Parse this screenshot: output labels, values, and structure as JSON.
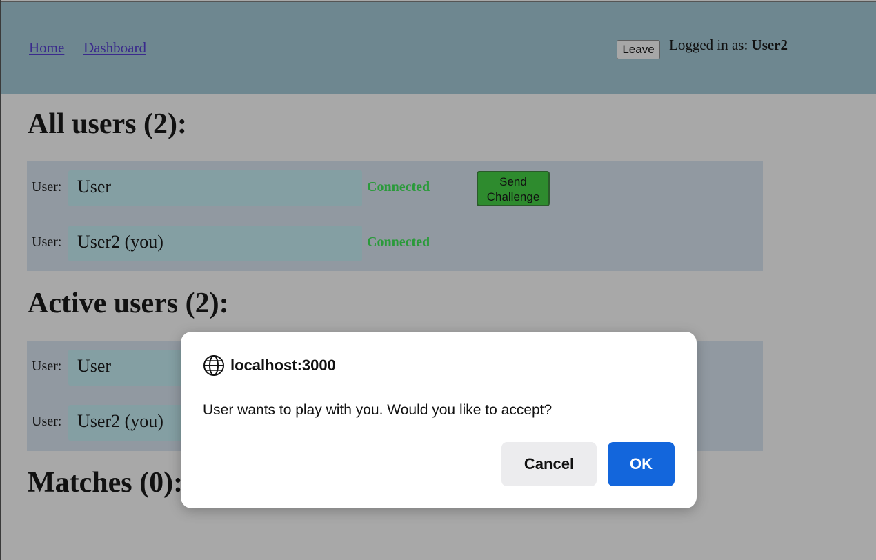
{
  "nav": {
    "home_label": "Home",
    "dashboard_label": "Dashboard",
    "leave_label": "Leave",
    "logged_in_prefix": "Logged in as: ",
    "logged_in_user": "User2"
  },
  "all_users": {
    "title": "All users (2):",
    "rows": [
      {
        "label": "User:",
        "name": "User",
        "status": "Connected",
        "action": "Send Challenge"
      },
      {
        "label": "User:",
        "name": "User2 (you)",
        "status": "Connected"
      }
    ]
  },
  "active_users": {
    "title": "Active users (2):",
    "rows": [
      {
        "label": "User:",
        "name": "User"
      },
      {
        "label": "User:",
        "name": "User2 (you)"
      }
    ]
  },
  "matches": {
    "title": "Matches (0):"
  },
  "dialog": {
    "origin": "localhost:3000",
    "message": "User wants to play with you. Would you like to accept?",
    "cancel_label": "Cancel",
    "ok_label": "OK"
  },
  "colors": {
    "header_bg": "#6e8790",
    "status_connected": "#2a9a3a",
    "challenge_button": "#2e8b2e",
    "ok_button": "#1366dc"
  },
  "icons": {
    "dialog_origin": "globe-icon"
  }
}
